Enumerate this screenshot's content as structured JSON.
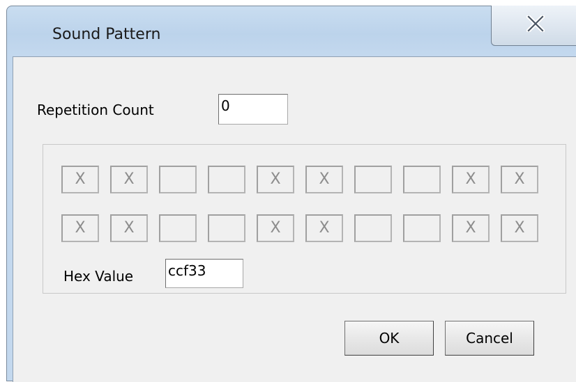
{
  "window": {
    "title": "Sound Pattern"
  },
  "form": {
    "repetition_label": "Repetition Count",
    "repetition_value": "0",
    "hex_label": "Hex Value",
    "hex_value": "ccf33"
  },
  "pattern": {
    "rows": [
      [
        "X",
        "X",
        "",
        "",
        "X",
        "X",
        "",
        "",
        "X",
        "X"
      ],
      [
        "X",
        "X",
        "",
        "",
        "X",
        "X",
        "",
        "",
        "X",
        "X"
      ]
    ]
  },
  "buttons": {
    "ok": "OK",
    "cancel": "Cancel"
  },
  "icons": {
    "close": "close-icon"
  },
  "colors": {
    "frame": "#c3d8ee",
    "client": "#f0f0f0",
    "cell_text": "#8c8c8c"
  }
}
